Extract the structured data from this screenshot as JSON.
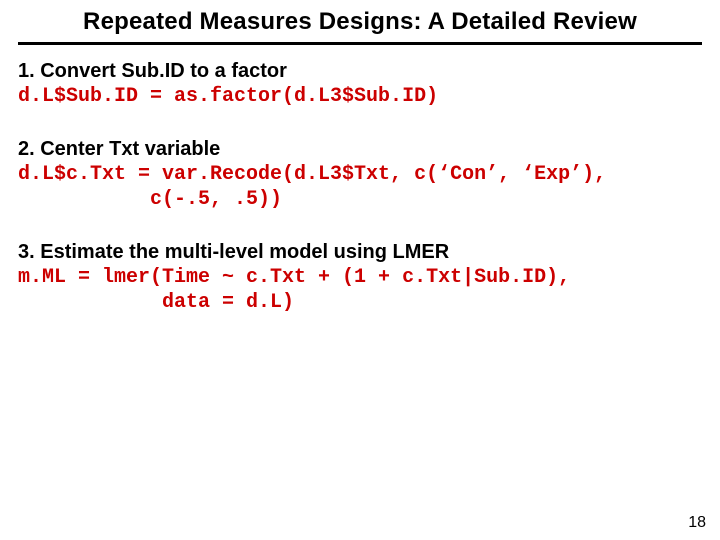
{
  "title": "Repeated Measures Designs:  A Detailed Review",
  "steps": {
    "s1": {
      "head": "1.  Convert Sub.ID to a factor",
      "code": "d.L$Sub.ID = as.factor(d.L3$Sub.ID)"
    },
    "s2": {
      "head": "2.  Center Txt variable",
      "code": "d.L$c.Txt = var.Recode(d.L3$Txt, c(‘Con’, ‘Exp’),\n           c(-.5, .5))"
    },
    "s3": {
      "head": "3.  Estimate the multi-level model using LMER",
      "code": "m.ML = lmer(Time ~ c.Txt + (1 + c.Txt|Sub.ID),\n            data = d.L)"
    }
  },
  "page_number": "18"
}
